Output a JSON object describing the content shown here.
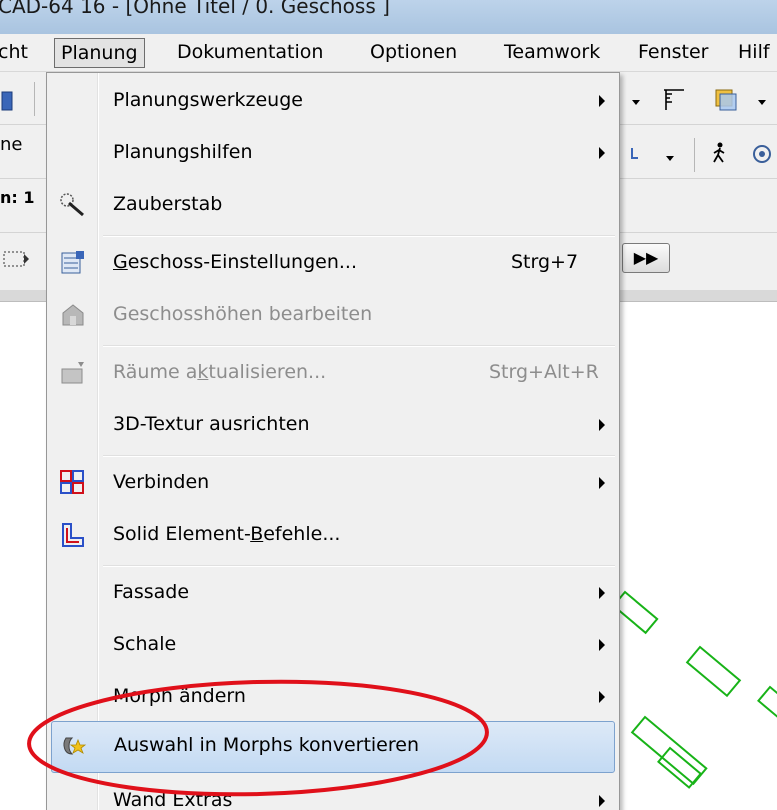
{
  "window": {
    "title": "CAD-64 16 - [Ohne Titel / 0. Geschoss ]"
  },
  "menubar": {
    "items": [
      "cht",
      "Planung",
      "Dokumentation",
      "Optionen",
      "Teamwork",
      "Fenster",
      "Hilf"
    ],
    "active": "Planung"
  },
  "toolbar": {
    "left_text_1": "ne",
    "left_text_2": "n: 1",
    "next_button": "▶▶"
  },
  "menu": {
    "items": [
      {
        "label": "Planungswerkzeuge",
        "submenu": true
      },
      {
        "label": "Planungshilfen",
        "submenu": true
      },
      {
        "label": "Zauberstab",
        "icon": "magic-wand-icon"
      },
      {
        "label_pre": "",
        "label_ul": "G",
        "label_post": "eschoss-Einstellungen...",
        "shortcut": "Strg+7",
        "icon": "story-settings-icon"
      },
      {
        "label": "Geschosshöhen bearbeiten",
        "disabled": true,
        "icon": "story-heights-icon"
      },
      {
        "label_pre": "Räume a",
        "label_ul": "k",
        "label_post": "tualisieren...",
        "shortcut": "Strg+Alt+R",
        "disabled": true,
        "icon": "update-zones-icon"
      },
      {
        "label": "3D-Textur ausrichten",
        "submenu": true
      },
      {
        "label": "Verbinden",
        "submenu": true,
        "icon": "connect-icon"
      },
      {
        "label_pre": "Solid Element-",
        "label_ul": "B",
        "label_post": "efehle...",
        "icon": "solid-element-icon"
      },
      {
        "label": "Fassade",
        "submenu": true
      },
      {
        "label": "Schale",
        "submenu": true
      },
      {
        "label": "Morph ändern",
        "submenu": true
      },
      {
        "label": "Auswahl in Morphs konvertieren",
        "highlighted": true,
        "icon": "convert-morph-icon"
      },
      {
        "label": "Wand Extras",
        "submenu": true
      }
    ]
  },
  "colors": {
    "annotation": "#e0101a",
    "highlight": "#c9ddf4",
    "drawing": "#18b318"
  }
}
